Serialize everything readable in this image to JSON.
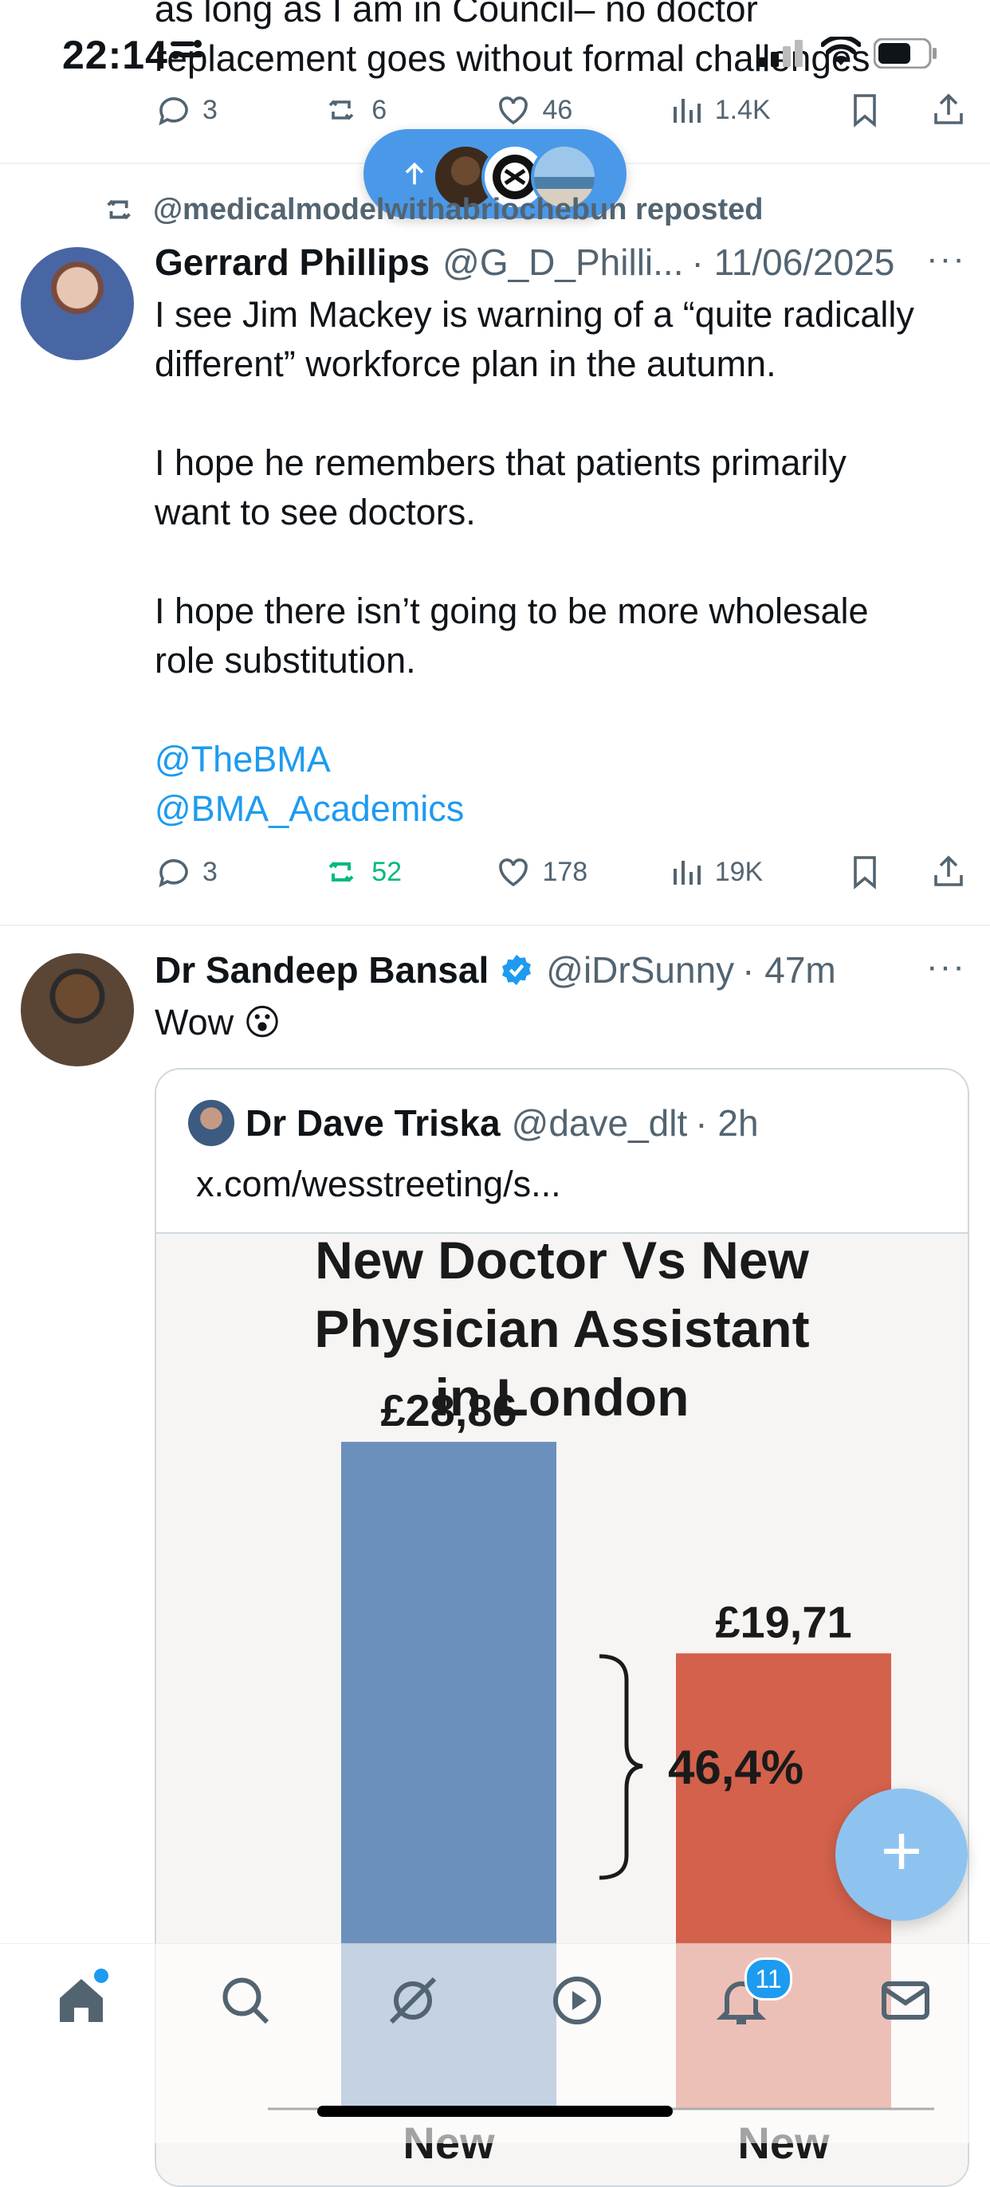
{
  "status": {
    "time": "22:14"
  },
  "prev_post": {
    "clipped_line1": "as long as I am in Council– no doctor",
    "clipped_line2": "replacement goes without formal challenges",
    "replies": "3",
    "reposts": "6",
    "likes": "46",
    "views": "1.4K"
  },
  "post1": {
    "repost_label": "@medicalmodelwithabriochebun reposted",
    "name": "Gerrard Phillips",
    "handle": "@G_D_Philli...",
    "date": "· 11/06/2025",
    "text_p1_l1": "I see Jim Mackey is warning of a “quite radically",
    "text_p1_l2": "different” workforce plan in the autumn.",
    "text_p2_l1": "I hope he remembers that patients primarily",
    "text_p2_l2": "want to see doctors.",
    "text_p3_l1": "I hope there isn’t going to be more wholesale",
    "text_p3_l2": "role substitution.",
    "mention1": "@TheBMA",
    "mention2": "@BMA_Academics",
    "replies": "3",
    "reposts": "52",
    "likes": "178",
    "views": "19K",
    "repost_color": "#00ba7c"
  },
  "post2": {
    "name": "Dr Sandeep Bansal",
    "handle": "@iDrSunny",
    "time": "· 47m",
    "text": "Wow 😮",
    "verified_color": "#1d9bf0",
    "quote": {
      "name": "Dr Dave Triska",
      "handle": "@dave_dlt",
      "time": "· 2h",
      "link": "x.com/wesstreeting/s..."
    }
  },
  "chart_data": {
    "type": "bar",
    "title_l1": "New Doctor Vs New",
    "title_l2": "Physician Assistant",
    "title_l3": "in London",
    "categories": [
      "New",
      "New"
    ],
    "values": [
      28.86,
      19.71
    ],
    "value_labels": [
      "£28,86",
      "£19,71"
    ],
    "difference_label": "46,4%",
    "colors": [
      "#6b90bb",
      "#d3614b"
    ],
    "ylim": [
      0,
      32
    ]
  },
  "fab": {
    "label": "+"
  },
  "tabbar": {
    "notification_count": "11"
  }
}
